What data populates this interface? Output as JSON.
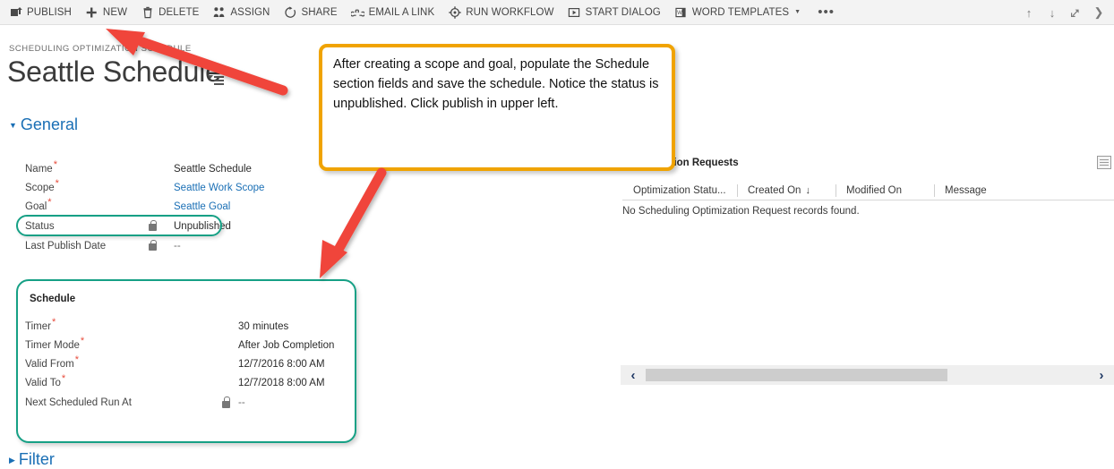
{
  "commandbar": {
    "items": [
      {
        "label": "PUBLISH",
        "icon": "publish-upload-icon",
        "caret": false
      },
      {
        "label": "NEW",
        "icon": "plus-icon",
        "caret": false
      },
      {
        "label": "DELETE",
        "icon": "trash-icon",
        "caret": false
      },
      {
        "label": "ASSIGN",
        "icon": "assign-people-icon",
        "caret": false
      },
      {
        "label": "SHARE",
        "icon": "share-circle-icon",
        "caret": false
      },
      {
        "label": "EMAIL A LINK",
        "icon": "link-chain-icon",
        "caret": false
      },
      {
        "label": "RUN WORKFLOW",
        "icon": "workflow-gear-icon",
        "caret": false
      },
      {
        "label": "START DIALOG",
        "icon": "play-box-icon",
        "caret": false
      },
      {
        "label": "WORD TEMPLATES",
        "icon": "word-document-icon",
        "caret": true
      }
    ],
    "overflow_label": "•••",
    "right_icons": [
      "arrow-up-icon",
      "arrow-down-icon",
      "pop-out-icon",
      "chevron-right-icon"
    ]
  },
  "record": {
    "breadcrumb": "SCHEDULING OPTIMIZATION SCHEDULE",
    "title": "Seattle Schedule"
  },
  "general": {
    "heading": "General",
    "fields": [
      {
        "label": "Name",
        "required": true,
        "locked": false,
        "value": "Seattle Schedule",
        "style": "plain"
      },
      {
        "label": "Scope",
        "required": true,
        "locked": false,
        "value": "Seattle Work Scope",
        "style": "link"
      },
      {
        "label": "Goal",
        "required": true,
        "locked": false,
        "value": "Seattle Goal",
        "style": "link"
      },
      {
        "label": "Status",
        "required": false,
        "locked": true,
        "value": "Unpublished",
        "style": "plain"
      },
      {
        "label": "Last Publish Date",
        "required": false,
        "locked": true,
        "value": "--",
        "style": "muted"
      }
    ]
  },
  "schedule_card": {
    "title": "Schedule",
    "fields": [
      {
        "label": "Timer",
        "required": true,
        "locked": false,
        "value": "30 minutes",
        "style": "plain"
      },
      {
        "label": "Timer Mode",
        "required": true,
        "locked": false,
        "value": "After Job Completion",
        "style": "plain"
      },
      {
        "label": "Valid From",
        "required": true,
        "locked": false,
        "value": "12/7/2016   8:00 AM",
        "style": "plain"
      },
      {
        "label": "Valid To",
        "required": true,
        "locked": false,
        "value": "12/7/2018   8:00 AM",
        "style": "plain"
      },
      {
        "label": "Next Scheduled Run At",
        "required": false,
        "locked": true,
        "value": "--",
        "style": "muted"
      }
    ]
  },
  "subgrid": {
    "title": "Optimization Requests",
    "columns": [
      {
        "label": "Optimization Statu...",
        "sort": ""
      },
      {
        "label": "Created On",
        "sort": "↓"
      },
      {
        "label": "Modified On",
        "sort": ""
      },
      {
        "label": "Message",
        "sort": ""
      }
    ],
    "empty_message": "No Scheduling Optimization Request records found.",
    "scroll_left_label": "‹",
    "scroll_right_label": "›"
  },
  "filter": {
    "heading": "Filter"
  },
  "callout": {
    "text": "After creating a scope and goal, populate the Schedule section fields and save the schedule.  Notice the status is unpublished. Click publish in upper left."
  },
  "colors": {
    "teal_highlight": "#16a085",
    "callout_border": "#f0a300",
    "arrow_red": "#f0453a",
    "link_blue": "#1a6fb5",
    "section_blue": "#1a6fb5",
    "required_red": "#e74c3c",
    "commandbar_bg": "#f3f3f3"
  }
}
